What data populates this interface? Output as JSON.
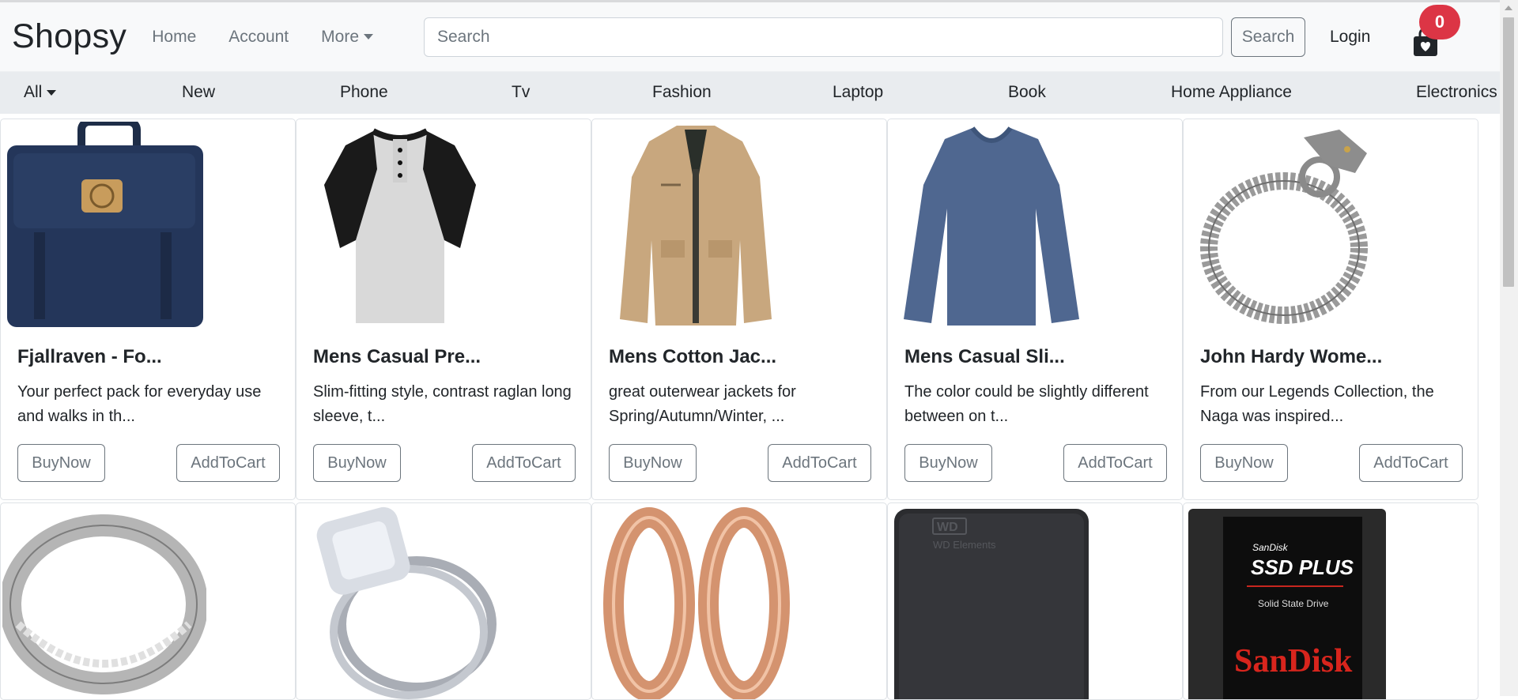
{
  "brand": "Shopsy",
  "nav": {
    "home": "Home",
    "account": "Account",
    "more": "More"
  },
  "search": {
    "placeholder": "Search",
    "button": "Search"
  },
  "login": "Login",
  "cart": {
    "count": "0",
    "icon": "shopping-bag-heart-icon"
  },
  "categories": {
    "all": "All",
    "items": [
      "New",
      "Phone",
      "Tv",
      "Fashion",
      "Laptop",
      "Book",
      "Home Appliance",
      "Electronics"
    ]
  },
  "products": [
    {
      "title": "Fjallraven - Fo...",
      "desc": "Your perfect pack for everyday use and walks in th...",
      "buy": "BuyNow",
      "add": "AddToCart",
      "image": "navy backpack"
    },
    {
      "title": "Mens Casual Pre...",
      "desc": "Slim-fitting style, contrast raglan long sleeve, t...",
      "buy": "BuyNow",
      "add": "AddToCart",
      "image": "raglan henley t-shirt"
    },
    {
      "title": "Mens Cotton Jac...",
      "desc": "great outerwear jackets for Spring/Autumn/Winter, ...",
      "buy": "BuyNow",
      "add": "AddToCart",
      "image": "beige cotton jacket"
    },
    {
      "title": "Mens Casual Sli...",
      "desc": "The color could be slightly different between on t...",
      "buy": "BuyNow",
      "add": "AddToCart",
      "image": "blue long sleeve shirt"
    },
    {
      "title": "John Hardy Wome...",
      "desc": "From our Legends Collection, the Naga was inspired...",
      "buy": "BuyNow",
      "add": "AddToCart",
      "image": "silver dragon bracelet"
    }
  ],
  "products_row2": [
    {
      "image": "silver ring"
    },
    {
      "image": "diamond engagement ring set"
    },
    {
      "image": "rose gold tunnel plugs"
    },
    {
      "image": "black external hard drive",
      "logo_text": "WD",
      "label_text": "WD Elements"
    },
    {
      "image": "sandisk ssd",
      "brand_small": "SanDisk",
      "model": "SSD PLUS",
      "subtitle": "Solid State Drive",
      "brand_big": "SanDisk"
    }
  ],
  "colors": {
    "badge": "#dc3545",
    "navbar": "#f8f9fa",
    "catbar": "#e9ecef",
    "border": "#dee2e6",
    "muted": "#6c757d"
  }
}
